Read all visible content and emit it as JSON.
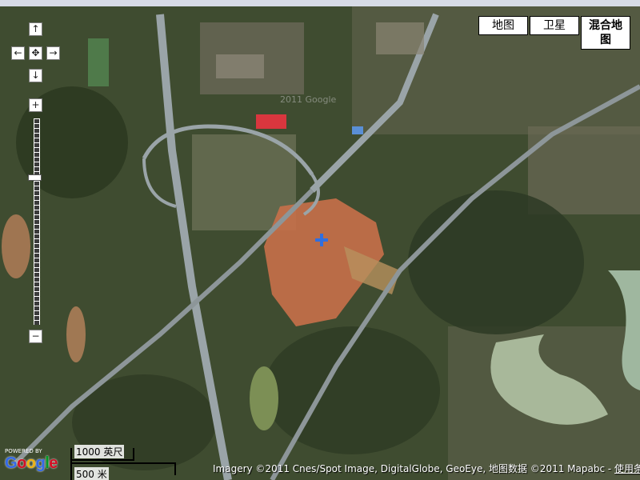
{
  "navigation": {
    "pan_up": "↑",
    "pan_left": "←",
    "pan_center": "✥",
    "pan_right": "→",
    "pan_down": "↓",
    "zoom_in": "+",
    "zoom_out": "−"
  },
  "map_types": {
    "map": "地图",
    "satellite": "卫星",
    "hybrid_line1": "混合地",
    "hybrid_line2": "图"
  },
  "selected_map_type": "hybrid",
  "scale": {
    "top_label": "1000 英尺",
    "bottom_label": "500 米"
  },
  "copyright": {
    "text": "Imagery ©2011 Cnes/Spot Image, DigitalGlobe, GeoEye, 地图数据 ©2011 Mapabc - ",
    "terms_link": "使用条款"
  },
  "branding": {
    "powered_by": "POWERED BY",
    "logo": [
      "G",
      "o",
      "o",
      "g",
      "l",
      "e"
    ],
    "logo_colors": [
      "#3369e8",
      "#d50f25",
      "#eeb211",
      "#3369e8",
      "#009925",
      "#d50f25"
    ]
  },
  "watermark": "2011 Google",
  "marker_icon": "crosshair-plus-icon",
  "colors": {
    "marker": "#2f6fe0",
    "road": "#9aa4a8",
    "bare_ground": "#c8704a",
    "river": "#a8b89a"
  }
}
